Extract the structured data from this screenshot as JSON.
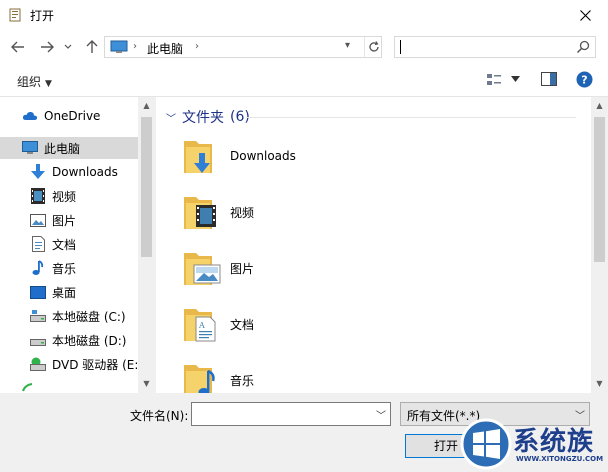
{
  "window": {
    "title": "打开"
  },
  "address": {
    "location": "此电脑"
  },
  "toolbar": {
    "organize": "组织"
  },
  "sidebar": {
    "items": [
      {
        "label": "OneDrive",
        "icon": "cloud-icon"
      },
      {
        "label": "此电脑",
        "icon": "computer-icon",
        "selected": true
      },
      {
        "label": "Downloads",
        "icon": "download-arrow-icon"
      },
      {
        "label": "视频",
        "icon": "video-icon"
      },
      {
        "label": "图片",
        "icon": "picture-icon"
      },
      {
        "label": "文档",
        "icon": "document-icon"
      },
      {
        "label": "音乐",
        "icon": "music-note-icon"
      },
      {
        "label": "桌面",
        "icon": "desktop-icon"
      },
      {
        "label": "本地磁盘 (C:)",
        "icon": "drive-icon"
      },
      {
        "label": "本地磁盘 (D:)",
        "icon": "drive-icon"
      },
      {
        "label": "DVD 驱动器 (E:)",
        "icon": "dvd-drive-icon"
      }
    ]
  },
  "main": {
    "group_title": "文件夹",
    "group_count": "(6)",
    "folders": [
      {
        "label": "Downloads",
        "icon": "downloads-folder-icon"
      },
      {
        "label": "视频",
        "icon": "video-folder-icon"
      },
      {
        "label": "图片",
        "icon": "picture-folder-icon"
      },
      {
        "label": "文档",
        "icon": "document-folder-icon"
      },
      {
        "label": "音乐",
        "icon": "music-folder-icon"
      }
    ]
  },
  "bottom": {
    "filename_label": "文件名(N):",
    "filename_value": "",
    "filetype": "所有文件(*.*)",
    "open_button": "打开"
  },
  "watermark": {
    "text": "系统族",
    "url": "WWW.XITONGZU.COM"
  },
  "colors": {
    "accent": "#0078d7",
    "group_title": "#1e3287",
    "folder": "#f5d36a"
  }
}
